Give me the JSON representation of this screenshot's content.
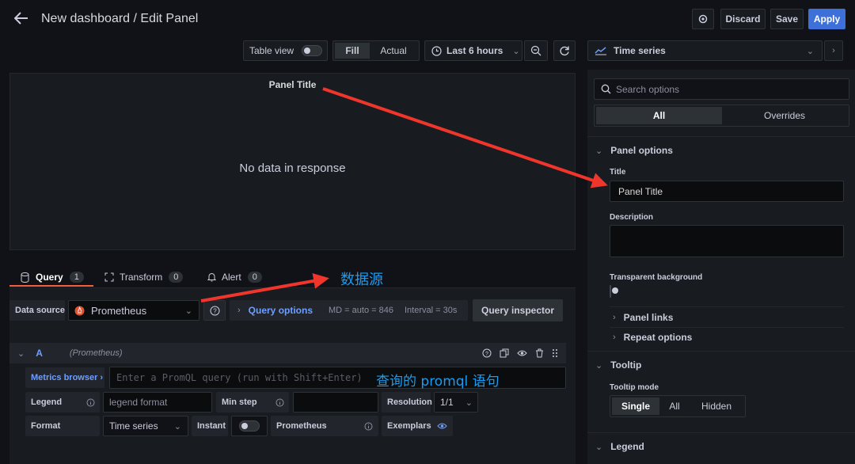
{
  "header": {
    "title": "New dashboard / Edit Panel",
    "discard_label": "Discard",
    "save_label": "Save",
    "apply_label": "Apply"
  },
  "toolbar": {
    "table_view_label": "Table view",
    "fill_label": "Fill",
    "actual_label": "Actual",
    "time_range_label": "Last 6 hours",
    "visualization_label": "Time series"
  },
  "panel": {
    "title": "Panel Title",
    "empty_message": "No data in response"
  },
  "query_tabs": [
    {
      "label": "Query",
      "count": "1"
    },
    {
      "label": "Transform",
      "count": "0"
    },
    {
      "label": "Alert",
      "count": "0"
    }
  ],
  "datasource": {
    "label": "Data source",
    "value": "Prometheus",
    "query_options_label": "Query options",
    "md_text": "MD = auto = 846",
    "interval_text": "Interval = 30s",
    "inspector_label": "Query inspector"
  },
  "query": {
    "ref_id": "A",
    "source_hint": "(Prometheus)",
    "metrics_browser_label": "Metrics browser ›",
    "promql_placeholder": "Enter a PromQL query (run with Shift+Enter)",
    "legend_label": "Legend",
    "legend_placeholder": "legend format",
    "min_step_label": "Min step",
    "resolution_label": "Resolution",
    "resolution_value": "1/1",
    "format_label": "Format",
    "format_value": "Time series",
    "instant_label": "Instant",
    "type_label": "Prometheus",
    "exemplars_label": "Exemplars"
  },
  "options": {
    "search_placeholder": "Search options",
    "all_tab": "All",
    "overrides_tab": "Overrides",
    "panel_options_label": "Panel options",
    "title_label": "Title",
    "title_value": "Panel Title",
    "description_label": "Description",
    "transparent_label": "Transparent background",
    "panel_links_label": "Panel links",
    "repeat_options_label": "Repeat options",
    "tooltip_label": "Tooltip",
    "tooltip_mode_label": "Tooltip mode",
    "tooltip_modes": [
      "Single",
      "All",
      "Hidden"
    ],
    "legend_label": "Legend"
  },
  "annotations": {
    "datasource_note": "数据源",
    "promql_note": "查询的 promql 语句"
  },
  "colors": {
    "accent": "#3d71d9",
    "link": "#6e9fff",
    "arrow": "#f0362c",
    "note": "#1a9cf0"
  }
}
